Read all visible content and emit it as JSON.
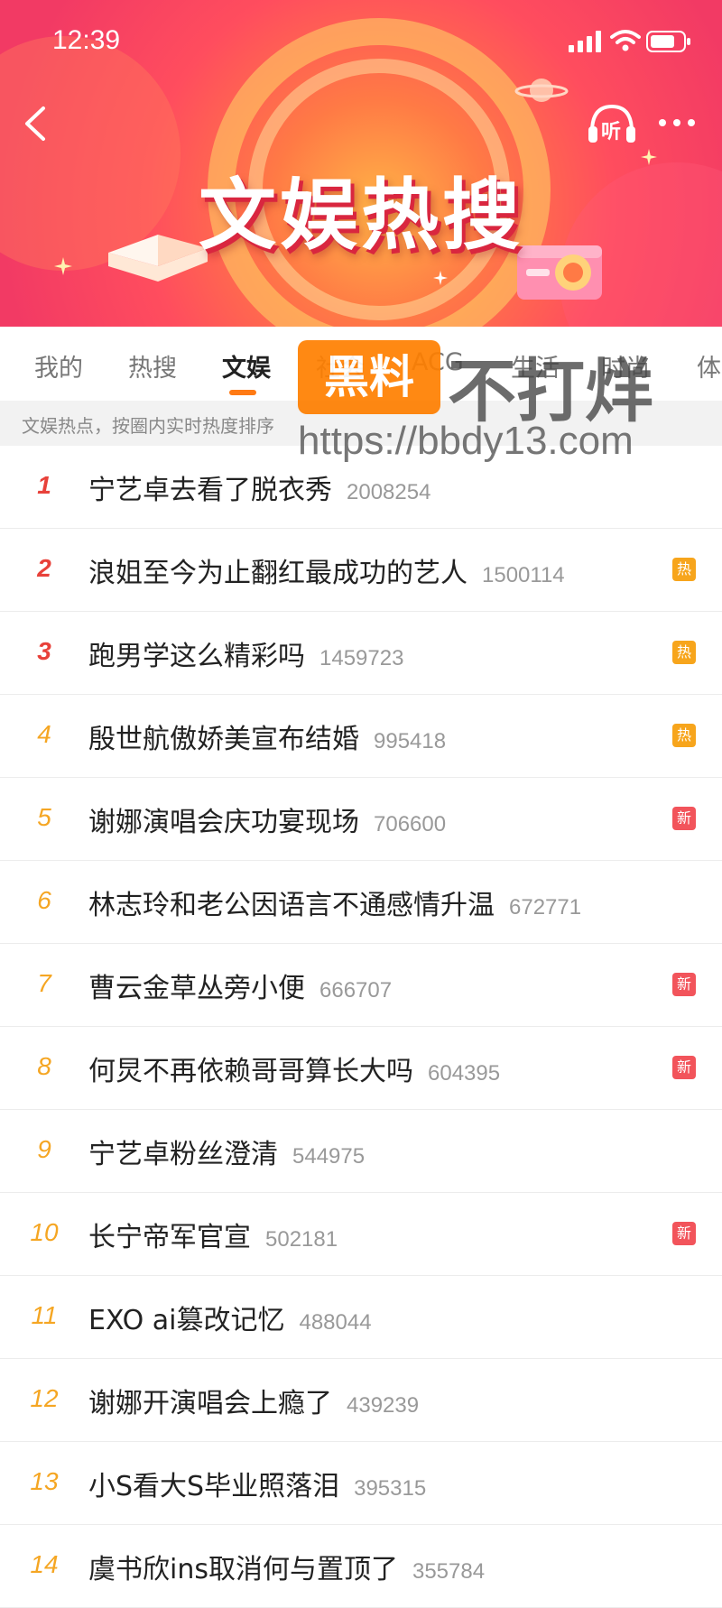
{
  "status_bar": {
    "time": "12:39"
  },
  "header": {
    "title": "文娱热搜",
    "listen_label": "听"
  },
  "tabs": [
    {
      "label": "我的"
    },
    {
      "label": "热搜"
    },
    {
      "label": "文娱",
      "active": true
    },
    {
      "label": "社会"
    },
    {
      "label": "ACG"
    },
    {
      "label": "生活"
    },
    {
      "label": "时尚"
    },
    {
      "label": "体"
    }
  ],
  "info_text": "文娱热点，按圈内实时热度排序",
  "list": [
    {
      "rank": "1",
      "topic": "宁艺卓去看了脱衣秀",
      "count": "2008254",
      "badge": ""
    },
    {
      "rank": "2",
      "topic": "浪姐至今为止翻红最成功的艺人",
      "count": "1500114",
      "badge": "热"
    },
    {
      "rank": "3",
      "topic": "跑男学这么精彩吗",
      "count": "1459723",
      "badge": "热"
    },
    {
      "rank": "4",
      "topic": "殷世航傲娇美宣布结婚",
      "count": "995418",
      "badge": "热"
    },
    {
      "rank": "5",
      "topic": "谢娜演唱会庆功宴现场",
      "count": "706600",
      "badge": "新"
    },
    {
      "rank": "6",
      "topic": "林志玲和老公因语言不通感情升温",
      "count": "672771",
      "badge": ""
    },
    {
      "rank": "7",
      "topic": "曹云金草丛旁小便",
      "count": "666707",
      "badge": "新"
    },
    {
      "rank": "8",
      "topic": "何炅不再依赖哥哥算长大吗",
      "count": "604395",
      "badge": "新"
    },
    {
      "rank": "9",
      "topic": "宁艺卓粉丝澄清",
      "count": "544975",
      "badge": ""
    },
    {
      "rank": "10",
      "topic": "长宁帝军官宣",
      "count": "502181",
      "badge": "新"
    },
    {
      "rank": "11",
      "topic": "EXO ai篡改记忆",
      "count": "488044",
      "badge": ""
    },
    {
      "rank": "12",
      "topic": "谢娜开演唱会上瘾了",
      "count": "439239",
      "badge": ""
    },
    {
      "rank": "13",
      "topic": "小S看大S毕业照落泪",
      "count": "395315",
      "badge": ""
    },
    {
      "rank": "14",
      "topic": "虞书欣ins取消何与置顶了",
      "count": "355784",
      "badge": ""
    }
  ],
  "watermark": {
    "box": "黑料",
    "text": "不打烊",
    "url": "https://bbdy13.com"
  },
  "colors": {
    "accent": "#ff7a14",
    "hot": "#f7a51c",
    "new": "#f2545b",
    "rank_top": "#e8413a",
    "rank": "#f5a623"
  }
}
